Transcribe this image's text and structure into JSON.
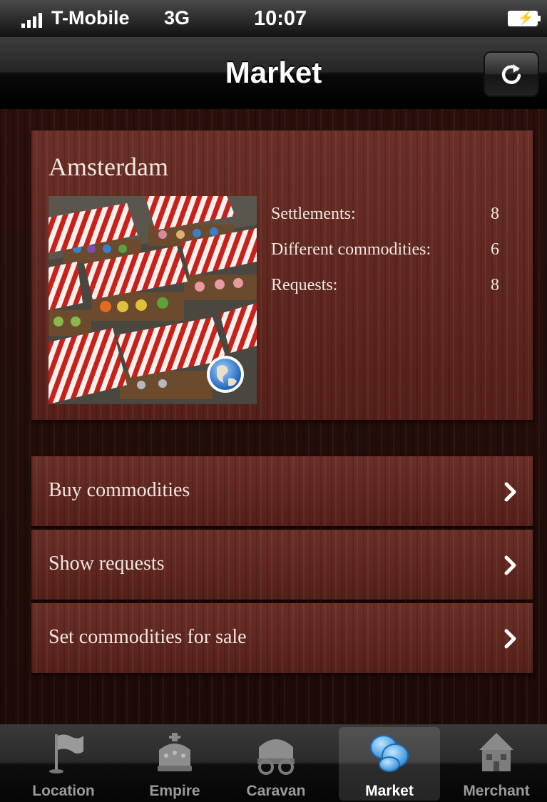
{
  "status_bar": {
    "carrier": "T-Mobile",
    "network": "3G",
    "time": "10:07"
  },
  "nav": {
    "title": "Market",
    "refresh_icon": "refresh-icon"
  },
  "market": {
    "city": "Amsterdam",
    "stats": [
      {
        "label": "Settlements:",
        "value": "8"
      },
      {
        "label": "Different commodities:",
        "value": "6"
      },
      {
        "label": "Requests:",
        "value": "8"
      }
    ]
  },
  "menu": [
    {
      "label": "Buy commodities"
    },
    {
      "label": "Show requests"
    },
    {
      "label": "Set commodities for sale"
    }
  ],
  "tabs": [
    {
      "label": "Location",
      "icon": "flag-icon",
      "selected": false
    },
    {
      "label": "Empire",
      "icon": "crown-icon",
      "selected": false
    },
    {
      "label": "Caravan",
      "icon": "wagon-icon",
      "selected": false
    },
    {
      "label": "Market",
      "icon": "coins-icon",
      "selected": true
    },
    {
      "label": "Merchant",
      "icon": "house-icon",
      "selected": false
    }
  ],
  "colors": {
    "wood_panel": "#5e251e",
    "wood_dark": "#1e0c08",
    "awning_red": "#c8211c"
  }
}
